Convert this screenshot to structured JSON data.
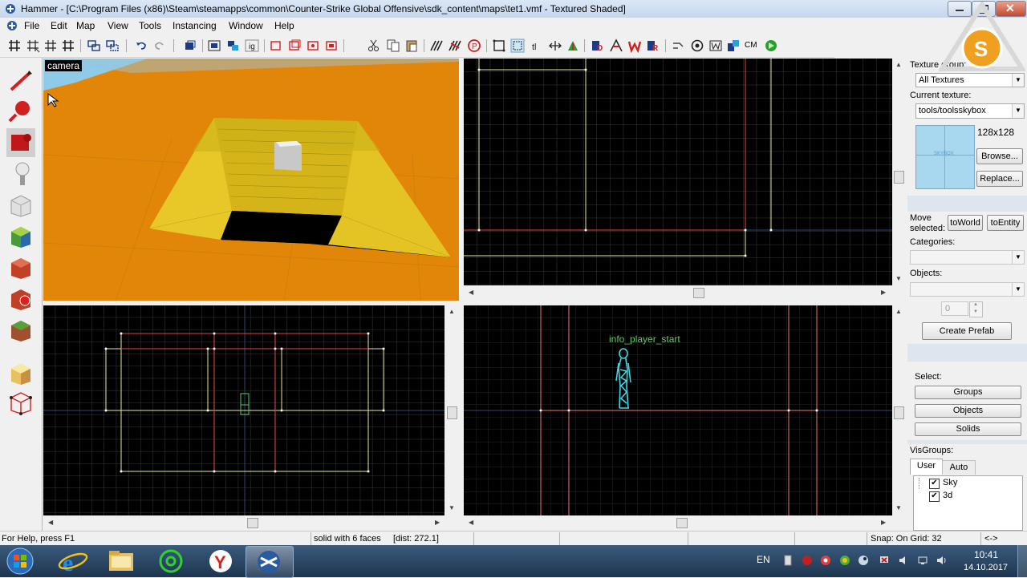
{
  "window": {
    "title": "Hammer - [C:\\Program Files (x86)\\Steam\\steamapps\\common\\Counter-Strike Global Offensive\\sdk_content\\maps\\tet1.vmf - Textured Shaded]"
  },
  "menu": [
    "File",
    "Edit",
    "Map",
    "View",
    "Tools",
    "Instancing",
    "Window",
    "Help"
  ],
  "toolbar": {
    "cm_label": "CM",
    "icons": [
      "grid-toggle-icon",
      "grid-smaller-icon",
      "grid-larger-icon",
      "grid-3d-icon",
      "group-icon",
      "ungroup-icon",
      "undo-icon",
      "redo-icon",
      "carve-icon",
      "hide-selected-icon",
      "show-all-icon",
      "ignore-groups-icon",
      "select-box-icon",
      "cut-icon",
      "copy-icon",
      "paste-icon",
      "texture-lock-icon",
      "texture-scale-lock-icon",
      "nodraw-icon",
      "selection-box-icon",
      "snap-icon",
      "tools-3d-icon",
      "center-views-icon",
      "entity-report-icon",
      "check-problems-icon",
      "flip-icon",
      "hollow-icon",
      "compile-icon",
      "run-map-icon",
      "cordon-icon",
      "overlay-icon",
      "area-portals-icon",
      "visgroups-icon",
      "nodraw-toggle-icon"
    ]
  },
  "palette": [
    "selection-tool-icon",
    "magnify-tool-icon",
    "camera-tool-icon",
    "entity-tool-icon",
    "block-tool-icon",
    "texture-application-icon",
    "apply-texture-icon",
    "decal-tool-icon",
    "overlay-tool-icon",
    "clipping-tool-icon",
    "vertex-manipulation-icon"
  ],
  "viewports": {
    "camera_label": "camera",
    "side_entity_label": "info_player_start"
  },
  "texture_panel": {
    "group_label": "Texture group:",
    "group_value": "All Textures",
    "current_label": "Current texture:",
    "current_value": "tools/toolsskybox",
    "size": "128x128",
    "preview_caption": "SKYBOX",
    "browse": "Browse...",
    "replace": "Replace..."
  },
  "move_panel": {
    "label": "Move selected:",
    "to_world": "toWorld",
    "to_entity": "toEntity"
  },
  "prefab_panel": {
    "categories_label": "Categories:",
    "objects_label": "Objects:",
    "count_value": "0",
    "create_prefab": "Create Prefab"
  },
  "select_panel": {
    "label": "Select:",
    "groups": "Groups",
    "objects": "Objects",
    "solids": "Solids"
  },
  "visgroups": {
    "label": "VisGroups:",
    "tabs": [
      "User",
      "Auto"
    ],
    "items": [
      {
        "label": "Sky",
        "checked": true
      },
      {
        "label": "3d",
        "checked": true
      }
    ]
  },
  "status": {
    "help": "For Help, press F1",
    "selection": "solid with 6 faces",
    "dist": "[dist: 272.1]",
    "snap": "Snap: On Grid: 32",
    "arrows": "<->"
  },
  "taskbar": {
    "apps": [
      "start-orb-icon",
      "internet-explorer-icon",
      "file-explorer-icon",
      "mail-agent-icon",
      "yandex-browser-icon",
      "hammer-editor-icon"
    ],
    "lang": "EN",
    "time": "10:41",
    "date": "14.10.2017"
  },
  "colors": {
    "accent_red": "#e82a2a",
    "grid_yellow": "#e8e89a",
    "entity_green": "#64c864",
    "entity_cyan": "#3cd8e8",
    "logo_orange": "#f0a020"
  }
}
